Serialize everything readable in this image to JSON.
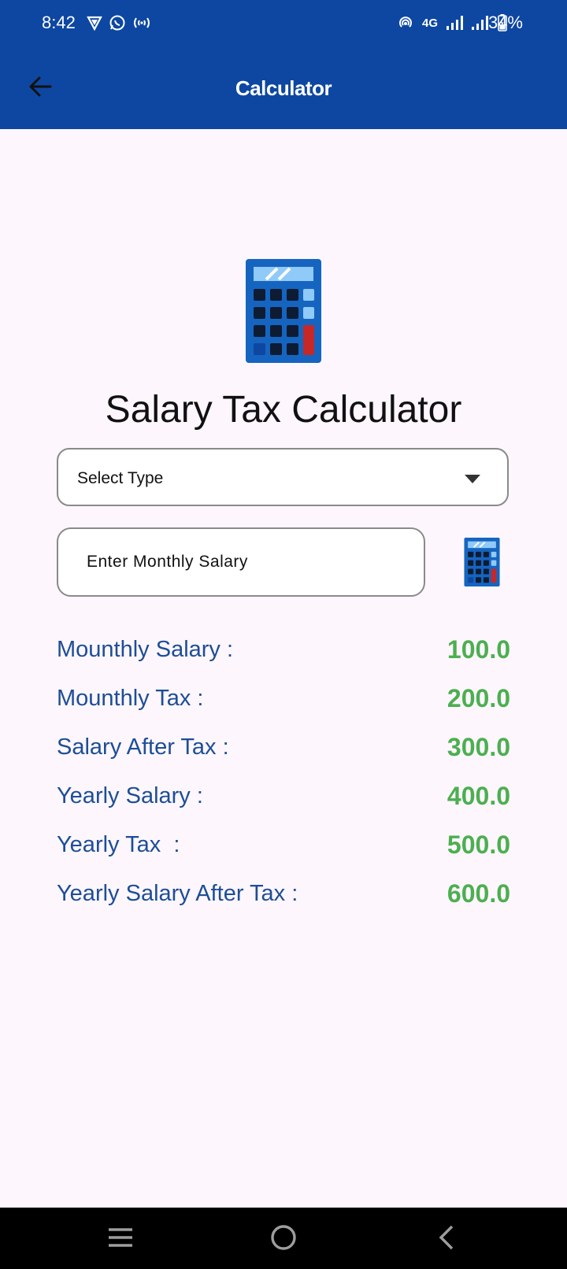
{
  "status_bar": {
    "time": "8:42",
    "network": "4G",
    "battery": "34%",
    "left_icons": [
      "vpn-icon",
      "whatsapp-icon",
      "cast-icon"
    ],
    "right_icons": [
      "hotspot-icon",
      "signal-icon",
      "signal-icon-2",
      "battery-icon"
    ]
  },
  "app_bar": {
    "title": "Calculator",
    "back_icon": "arrow-left-icon",
    "color": "#0d47a1"
  },
  "main": {
    "hero_icon": "calculator-icon",
    "title": "Salary Tax Calculator",
    "select_type": {
      "label": "Select Type",
      "icon": "dropdown-caret-icon"
    },
    "salary_input": {
      "placeholder": "Enter Monthly Salary",
      "value": ""
    },
    "calculate_icon": "calculator-icon",
    "results": [
      {
        "label": "Mounthly Salary :",
        "value": "100.0"
      },
      {
        "label": "Mounthly Tax :",
        "value": "200.0"
      },
      {
        "label": "Salary After Tax :",
        "value": "300.0"
      },
      {
        "label": "Yearly Salary :",
        "value": "400.0"
      },
      {
        "label": "Yearly Tax  :",
        "value": "500.0"
      },
      {
        "label": "Yearly Salary After Tax :",
        "value": "600.0"
      }
    ],
    "label_color": "#1d4e96",
    "value_color": "#4caf50"
  },
  "nav_bar": {
    "items": [
      "recents-icon",
      "home-icon",
      "back-icon"
    ]
  }
}
